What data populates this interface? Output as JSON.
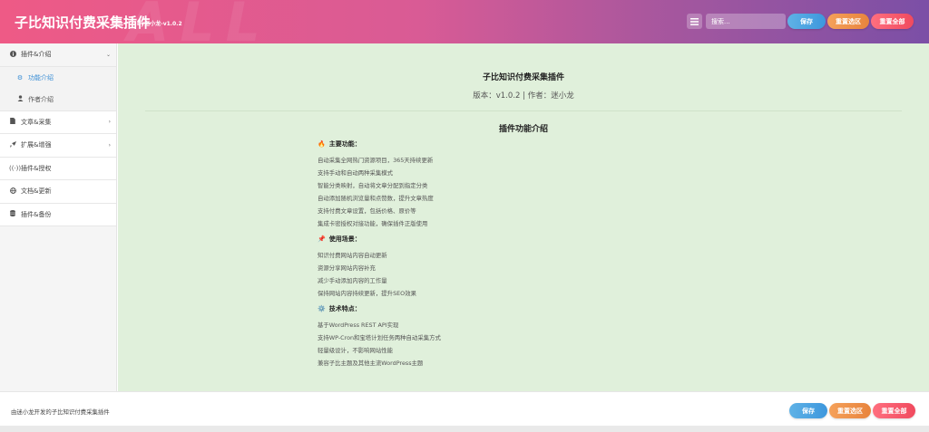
{
  "header": {
    "title": "子比知识付费采集插件",
    "byline": "by迷小龙-v1.0.2",
    "search_placeholder": "搜索...",
    "save": "保存",
    "reset_section": "重置选区",
    "reset_all": "重置全部"
  },
  "sidebar": {
    "items": [
      {
        "label": "插件&介绍",
        "icon": "info-icon"
      },
      {
        "label": "文章&采集",
        "icon": "document-icon"
      },
      {
        "label": "扩展&增强",
        "icon": "rocket-icon"
      },
      {
        "label": "插件&授权",
        "icon": "signal-icon"
      },
      {
        "label": "文档&更新",
        "icon": "globe-icon"
      },
      {
        "label": "插件&备份",
        "icon": "database-icon"
      }
    ],
    "subitems": [
      {
        "label": "功能介绍",
        "icon": "gears-icon"
      },
      {
        "label": "作者介绍",
        "icon": "user-icon"
      }
    ]
  },
  "content": {
    "plugin_title": "子比知识付费采集插件",
    "version_line": "版本：v1.0.2 | 作者：迷小龙",
    "intro_title": "插件功能介绍",
    "main": {
      "heading": "主要功能：",
      "lines": [
        "自动采集全网热门资源项目，365天持续更新",
        "支持手动和自动两种采集模式",
        "智能分类映射，自动将文章分配到指定分类",
        "自动添加随机浏览量和点赞数，提升文章热度",
        "支持付费文章设置，包括价格、原价等",
        "集成卡密授权对接功能，确保插件正版使用"
      ]
    },
    "usage": {
      "heading": "使用场景：",
      "lines": [
        "知识付费网站内容自动更新",
        "资源分享网站内容补充",
        "减少手动添加内容的工作量",
        "保持网站内容持续更新，提升SEO效果"
      ]
    },
    "tech": {
      "heading": "技术特点：",
      "lines": [
        "基于WordPress REST API实现",
        "支持WP-Cron和宝塔计划任务两种自动采集方式",
        "轻量级设计，不影响网站性能",
        "兼容子比主题及其他主流WordPress主题"
      ]
    }
  },
  "footer": {
    "text": "由迷小龙开发的子比知识付费采集插件",
    "save": "保存",
    "reset_section": "重置选区",
    "reset_all": "重置全部"
  }
}
